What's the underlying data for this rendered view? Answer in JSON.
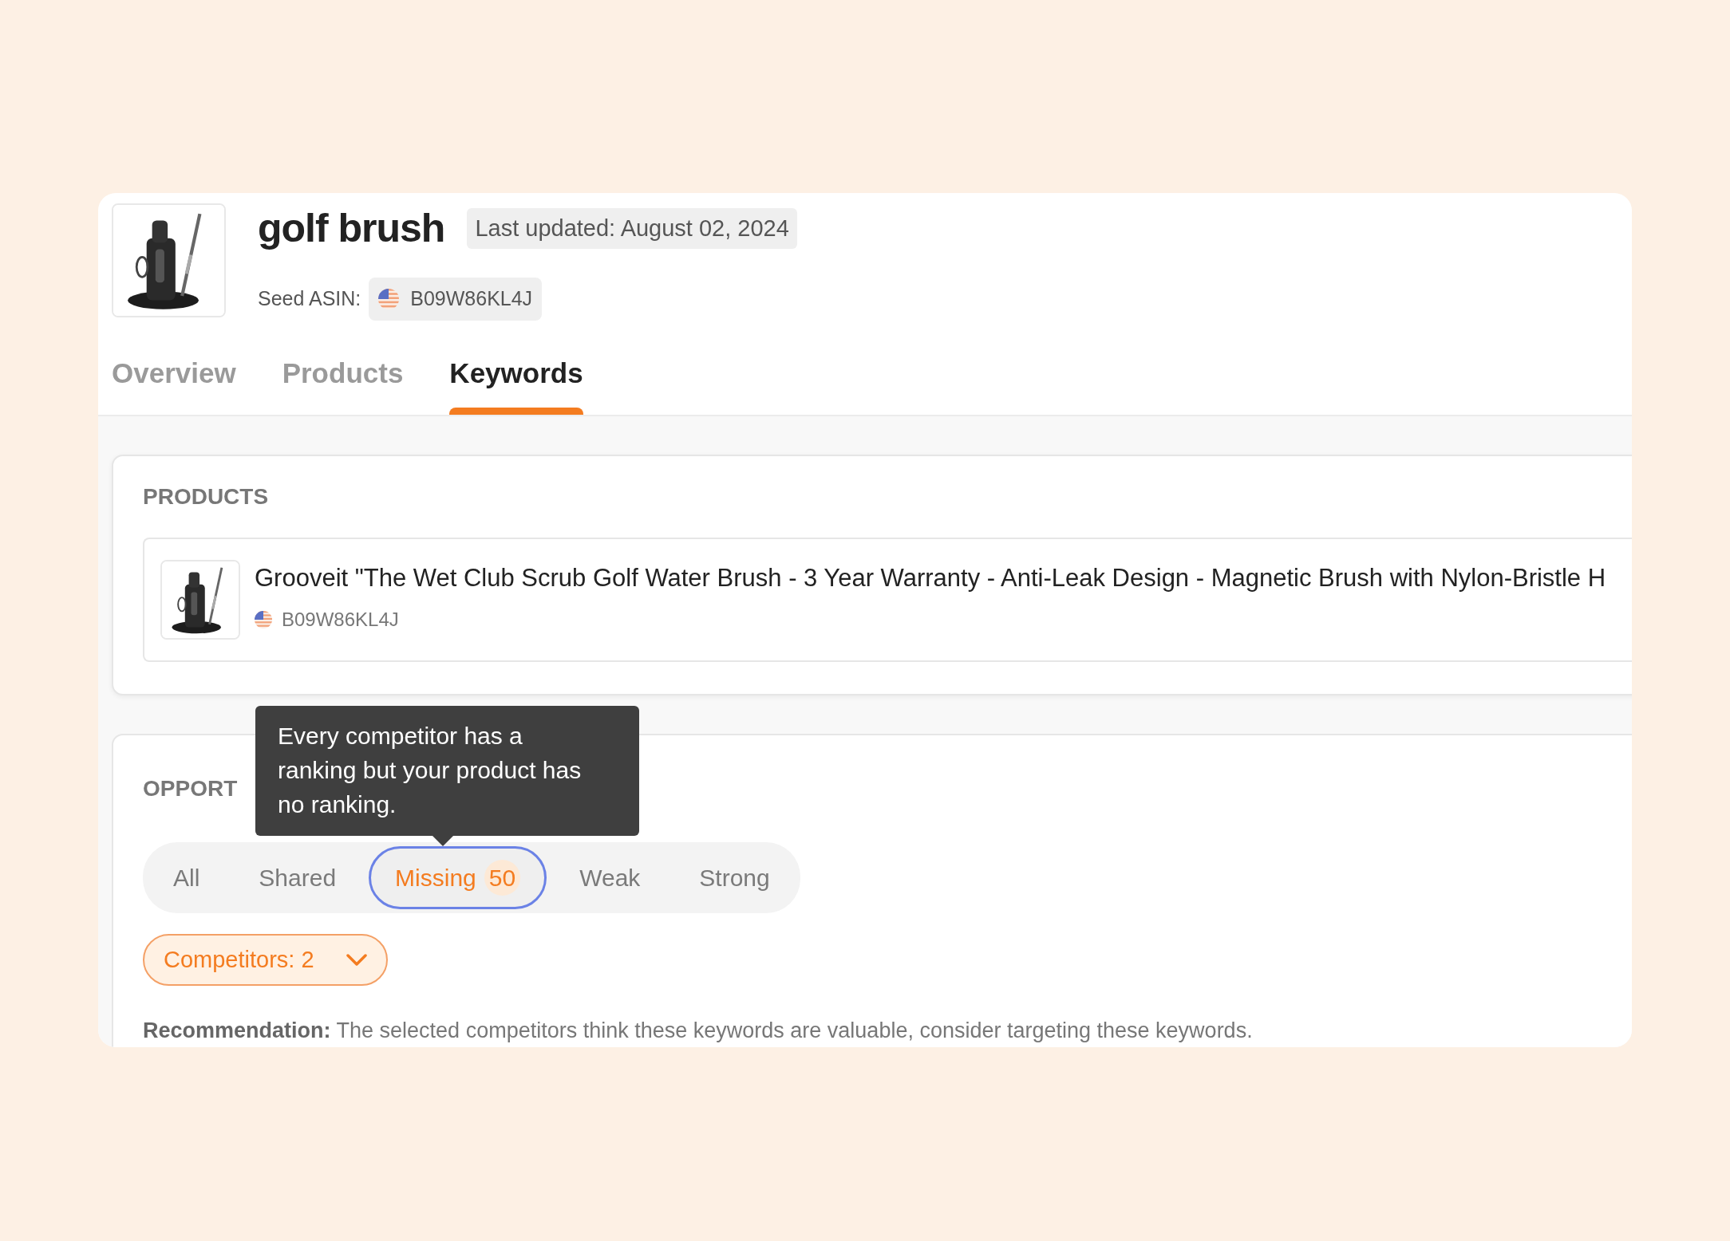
{
  "header": {
    "title": "golf brush",
    "last_updated": "Last updated: August 02, 2024",
    "seed_label": "Seed ASIN:",
    "seed_asin": "B09W86KL4J"
  },
  "tabs": [
    {
      "label": "Overview",
      "selected": false
    },
    {
      "label": "Products",
      "selected": false
    },
    {
      "label": "Keywords",
      "selected": true
    }
  ],
  "products_section": {
    "heading": "PRODUCTS",
    "items": [
      {
        "title": "Grooveit \"The Wet Club Scrub Golf Water Brush - 3 Year Warranty - Anti-Leak Design - Magnetic Brush with Nylon-Bristle H",
        "asin": "B09W86KL4J"
      }
    ]
  },
  "opportunities": {
    "heading": "OPPORT",
    "tooltip": "Every competitor has a ranking but your product has no ranking.",
    "filters": [
      {
        "label": "All",
        "selected": false
      },
      {
        "label": "Shared",
        "selected": false
      },
      {
        "label": "Missing",
        "count": "50",
        "selected": true
      },
      {
        "label": "Weak",
        "selected": false
      },
      {
        "label": "Strong",
        "selected": false
      }
    ],
    "competitors": "Competitors: 2",
    "recommendation": "**Recommendation:** The selected competitors think these keywords are valuable, consider targeting these keywords."
  }
}
